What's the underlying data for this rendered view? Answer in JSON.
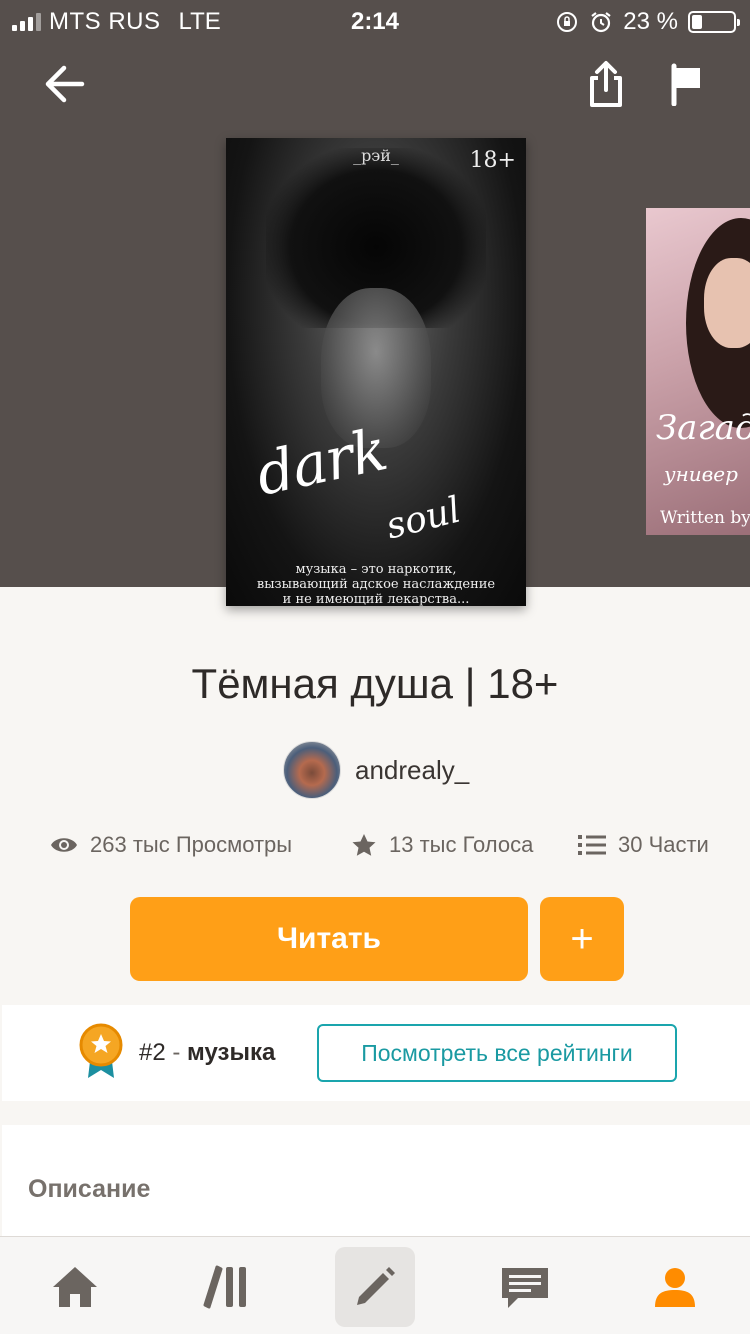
{
  "status_bar": {
    "carrier": "MTS RUS",
    "network": "LTE",
    "time": "2:14",
    "battery": "23 %"
  },
  "nav": {
    "back_icon": "arrow-left-icon",
    "share_icon": "share-icon",
    "report_icon": "flag-icon"
  },
  "cover": {
    "author": "_рэй_",
    "age": "18+",
    "script_title": "dark",
    "script_title2": "soul",
    "tagline": "музыка – это наркотик, вызывающий адское наслаждение и не имеющий лекарства..."
  },
  "next_cover": {
    "title": "Загад",
    "subtitle": "универ",
    "credit": "Written by:"
  },
  "story": {
    "title": "Тёмная душа | 18+",
    "author": "andrealy_"
  },
  "stats": {
    "views": "263 тыс Просмотры",
    "votes": "13 тыс Голоса",
    "parts": "30 Части"
  },
  "actions": {
    "read_label": "Читать",
    "add_label": "+"
  },
  "ranking": {
    "rank": "#2",
    "separator": "-",
    "tag": "музыка",
    "view_all_label": "Посмотреть все рейтинги"
  },
  "description": {
    "heading": "Описание"
  },
  "tab_bar": {
    "items": [
      {
        "icon": "home-icon",
        "active": false
      },
      {
        "icon": "library-icon",
        "active": false
      },
      {
        "icon": "pencil-icon",
        "active": true
      },
      {
        "icon": "messages-icon",
        "active": false
      },
      {
        "icon": "profile-icon",
        "active": false
      }
    ]
  },
  "colors": {
    "header_bg": "#564f4c",
    "accent": "#ff9f17",
    "teal": "#1aa5ad",
    "page_bg": "#f8f6f3"
  }
}
